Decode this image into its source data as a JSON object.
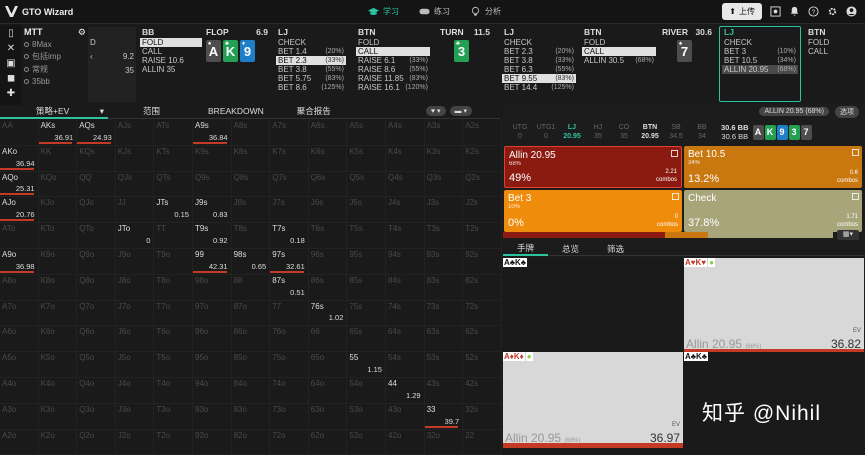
{
  "app": {
    "title": "GTO Wizard"
  },
  "nav": {
    "tabs": [
      {
        "label": "学习"
      },
      {
        "label": "练习"
      },
      {
        "label": "分析"
      }
    ],
    "upload": "上传"
  },
  "tournament": {
    "title": "MTT",
    "rows": [
      "8Max",
      "包括imp",
      "常规",
      "35bb"
    ]
  },
  "history": {
    "partial": {
      "label": "D",
      "items": [
        "9.2",
        "35"
      ]
    },
    "bb": {
      "name": "BB",
      "items": [
        "FOLD",
        "CALL",
        "RAISE 10.6",
        "ALLIN 35"
      ]
    },
    "flop": {
      "name": "FLOP",
      "pot": "6.9",
      "cards": [
        "A",
        "K",
        "9"
      ]
    },
    "lj1": {
      "name": "LJ",
      "items": [
        [
          "CHECK",
          ""
        ],
        [
          "BET 1.4",
          "(20%)"
        ],
        [
          "BET 2.3",
          "(33%)"
        ],
        [
          "BET 3.8",
          "(55%)"
        ],
        [
          "BET 5.75",
          "(83%)"
        ],
        [
          "BET 8.6",
          "(125%)"
        ]
      ]
    },
    "btn1": {
      "name": "BTN",
      "items": [
        [
          "FOLD",
          ""
        ],
        [
          "CALL",
          ""
        ],
        [
          "RAISE 6.1",
          "(33%)"
        ],
        [
          "RAISE 8.6",
          "(55%)"
        ],
        [
          "RAISE 11.85",
          "(83%)"
        ],
        [
          "RAISE 16.1",
          "(120%)"
        ]
      ]
    },
    "turn": {
      "name": "TURN",
      "pot": "11.5",
      "cards": [
        "3"
      ]
    },
    "lj2": {
      "name": "LJ",
      "items": [
        [
          "CHECK",
          ""
        ],
        [
          "BET 2.3",
          "(20%)"
        ],
        [
          "BET 3.8",
          "(33%)"
        ],
        [
          "BET 6.3",
          "(55%)"
        ],
        [
          "BET 9.55",
          "(83%)"
        ],
        [
          "BET 14.4",
          "(125%)"
        ]
      ]
    },
    "btn2": {
      "name": "BTN",
      "items": [
        [
          "FOLD",
          ""
        ],
        [
          "CALL",
          ""
        ],
        [
          "ALLIN 30.5",
          "(68%)"
        ]
      ]
    },
    "river": {
      "name": "RIVER",
      "pot": "30.6",
      "cards": [
        "7"
      ]
    },
    "lj3": {
      "name": "LJ",
      "items": [
        [
          "CHECK",
          ""
        ],
        [
          "BET 3",
          "(10%)"
        ],
        [
          "BET 10.5",
          "(34%)"
        ],
        [
          "ALLIN 20.95",
          "(68%)"
        ]
      ]
    },
    "btn3": {
      "name": "BTN",
      "items": [
        [
          "FOLD",
          ""
        ],
        [
          "CALL",
          ""
        ]
      ]
    }
  },
  "segment": {
    "strategy": "策略+EV",
    "range": "范围",
    "breakdown": "BREAKDOWN",
    "report": "聚合报告"
  },
  "matrix": {
    "cols": [
      "A",
      "K",
      "Q",
      "J",
      "T",
      "9",
      "8",
      "7",
      "6",
      "5",
      "4",
      "3",
      "2"
    ],
    "on": {
      "AKs": "36.91",
      "AQs": "24.93",
      "A9s": "36.84",
      "AKo": "36.94",
      "AQo": "25.31",
      "AJo": "20.76",
      "JTs": "0.15",
      "J9s": "0.83",
      "JTo": "0",
      "T9s": "0.92",
      "T7s": "0.18",
      "A9o": "36.98",
      "99": "42.31",
      "98s": "0.65",
      "97s": "32.61",
      "87s": "0.51",
      "76s": "1.02",
      "55": "1.15",
      "44": "1.29",
      "33": "39.7"
    }
  },
  "right": {
    "filter": "ALLIN 20.95 (68%)",
    "filter2": "选项",
    "seats": [
      [
        "UTG",
        "0"
      ],
      [
        "UTG1",
        "0"
      ],
      [
        "LJ",
        "20.95"
      ],
      [
        "HJ",
        "35"
      ],
      [
        "CO",
        "35"
      ],
      [
        "BTN",
        "20.95"
      ],
      [
        "SB",
        "34.5"
      ],
      [
        "BB",
        "34"
      ]
    ],
    "pot": [
      "30.6 BB",
      "30.6 BB"
    ],
    "board": [
      "A",
      "K",
      "9",
      "3",
      "7"
    ],
    "actions": [
      {
        "name": "Allin 20.95",
        "pct": "68%",
        "freq": "49%",
        "combos": "2.21",
        "color": "#8b1a10"
      },
      {
        "name": "Bet 10.5",
        "pct": "34%",
        "freq": "13.2%",
        "combos": "0.6",
        "color": "#c8780e"
      },
      {
        "name": "Bet 3",
        "pct": "10%",
        "freq": "0%",
        "combos": "0",
        "color": "#f08c0c"
      },
      {
        "name": "Check",
        "pct": "",
        "freq": "37.8%",
        "combos": "1.71",
        "color": "#a9a57a"
      }
    ],
    "subtabs": [
      "手牌",
      "总览",
      "筛选"
    ],
    "hands": [
      {
        "label": "A♣K♣",
        "ev": "",
        "action": "",
        "value": ""
      },
      {
        "label": "A♥K♥",
        "ev": "EV",
        "action": "Allin 20.95",
        "pct": "(68%)",
        "value": "36.82"
      },
      {
        "label": "A♦K♦",
        "ev": "EV",
        "action": "Allin 20.95",
        "pct": "(68%)",
        "value": "36.97"
      },
      {
        "label": "A♣K♣",
        "ev": "",
        "action": "",
        "value": ""
      }
    ],
    "combo_label": "combos"
  },
  "watermark": "知乎 @Nihil"
}
